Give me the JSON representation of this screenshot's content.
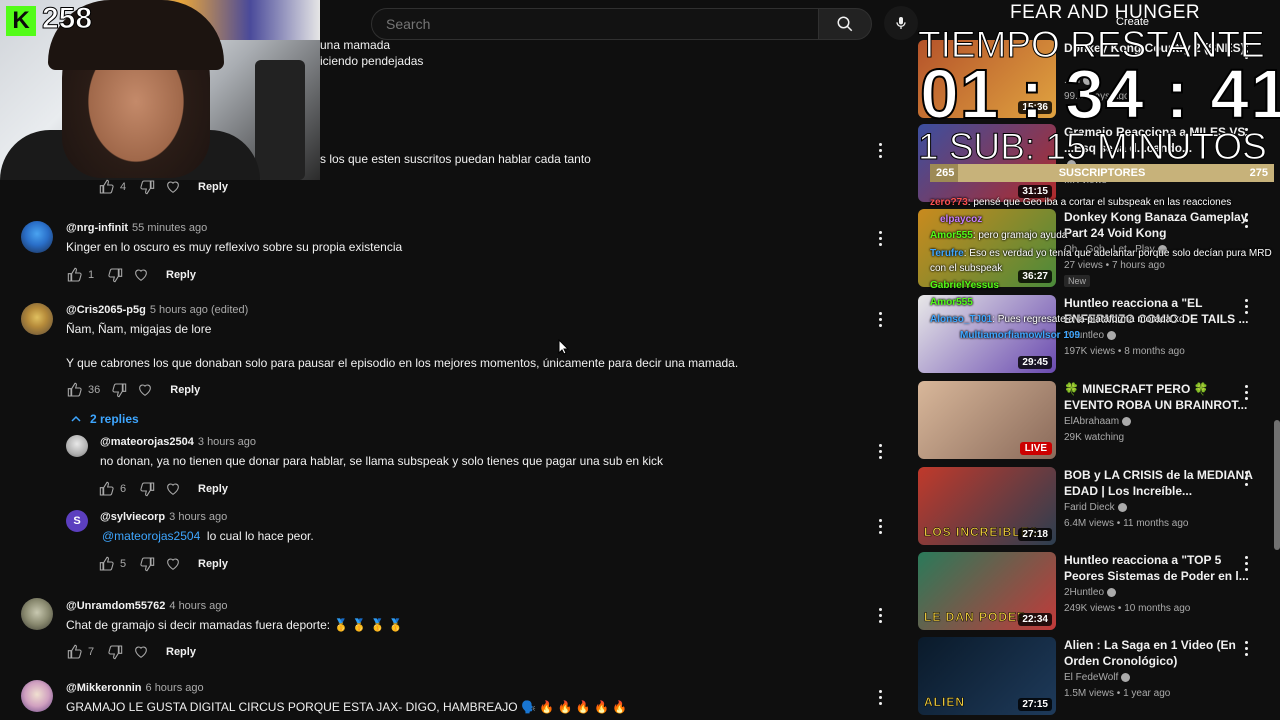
{
  "search": {
    "placeholder": "Search"
  },
  "webcam": {
    "kick_count": "258",
    "kick_letter": "K"
  },
  "partial_comments": [
    {
      "text": "una mamada"
    },
    {
      "text": "iciendo pendejadas"
    },
    {
      "text": "s los que esten suscritos puedan hablar cada tanto"
    }
  ],
  "partial_actions": {
    "likes": "4",
    "reply_label": "Reply"
  },
  "comments": [
    {
      "author": "@nrg-infinit",
      "time": "55 minutes ago",
      "text": "Kinger en lo oscuro es muy reflexivo sobre su propia existencia",
      "likes": "1",
      "reply_label": "Reply"
    },
    {
      "author": "@Cris2065-p5g",
      "time": "5 hours ago (edited)",
      "text": "Ñam, Ñam, migajas de lore",
      "text2": "Y que cabrones los que donaban solo para pausar el episodio en los mejores momentos, únicamente para decir una mamada.",
      "likes": "36",
      "reply_label": "Reply",
      "replies_label": "2 replies"
    },
    {
      "author": "@mateorojas2504",
      "time": "3 hours ago",
      "text": "no donan, ya no tienen que donar para hablar, se llama subspeak y solo tienes que pagar una sub en kick",
      "likes": "6",
      "reply_label": "Reply"
    },
    {
      "author": "@sylviecorp",
      "time": "3 hours ago",
      "mention": "@mateorojas2504",
      "text": "lo cual lo hace peor.",
      "likes": "5",
      "reply_label": "Reply",
      "avatar_letter": "S"
    },
    {
      "author": "@Unramdom55762",
      "time": "4 hours ago",
      "text": "Chat de gramajo si decir mamadas fuera deporte: 🥇 🥇 🥇 🥇",
      "likes": "7",
      "reply_label": "Reply"
    },
    {
      "author": "@Mikkeronnin",
      "time": "6 hours ago",
      "text": "GRAMAJO LE GUSTA DIGITAL CIRCUS PORQUE ESTA JAX- DIGO, HAMBREAJO 🗣️ 🔥 🔥 🔥 🔥 🔥"
    }
  ],
  "overlay": {
    "title": "FEAR AND HUNGER",
    "create": "Create",
    "big": "TIEMPO RESTANTE",
    "timer": "01 : 34 : 41",
    "sub_rule": "1 SUB: 15 MINUTOS",
    "subs_min": "265",
    "subs_label": "SUSCRIPTORES",
    "subs_max": "275"
  },
  "chat": [
    {
      "user": "zero?73",
      "msg": ": pensé que Geo iba a cortar el subspeak en las reacciones"
    },
    {
      "user": "elpaycoz",
      "msg": ""
    },
    {
      "user": "Amor555",
      "msg": ": pero gramajo ayuda"
    },
    {
      "user": "Terufre",
      "msg": ": Eso es verdad yo tenía que adelantar porque solo decían pura MRD"
    },
    {
      "user": "",
      "msg": "con el subspeak"
    },
    {
      "user": "GabrielYessus",
      "msg": ""
    },
    {
      "user": "Amor555",
      "msg": ""
    },
    {
      "user": "Alonso_TJ01",
      "msg": ": Pues regresate a la plataforma morada xd"
    },
    {
      "user": "Multiamorfiamowlsor 109",
      "msg": ""
    }
  ],
  "videos": [
    {
      "title": "Donkey Kong Country 2 (SNES)",
      "channel": "...ni",
      "meta": "99... ...ays ago",
      "duration": "15:36",
      "colors": [
        "#b5532a",
        "#e0a340"
      ]
    },
    {
      "title": "Gramajo Reacciona a MILES VS ...Esq se la d...cando...",
      "channel": "",
      "meta": "...K views",
      "duration": "31:15",
      "colors": [
        "#3b4fa0",
        "#b22a2a"
      ]
    },
    {
      "title": "Donkey Kong Banaza Gameplay Part 24 Void Kong",
      "channel": "Oh...Goh...Let...Play",
      "meta": "27 views • 7 hours ago",
      "new": "New",
      "duration": "36:27",
      "colors": [
        "#c98a1e",
        "#4a8a3a"
      ]
    },
    {
      "title": "Huntleo reacciona a \"EL ENFERMIZO COMIC DE TAILS ...",
      "channel": "2Huntleo",
      "meta": "197K views • 8 months ago",
      "duration": "29:45",
      "colors": [
        "#e8e8e8",
        "#6a4ab0"
      ]
    },
    {
      "title": "🍀 MINECRAFT PERO 🍀 EVENTO ROBA UN BRAINROT...",
      "channel": "ElAbrahaam",
      "meta": "29K watching",
      "live": "LIVE",
      "colors": [
        "#d8b79a",
        "#8a6a5a"
      ]
    },
    {
      "title": "BOB y LA CRISIS de la MEDIANA EDAD | Los Increíble...",
      "channel": "Farid Dieck",
      "meta": "6.4M views • 11 months ago",
      "duration": "27:18",
      "colors": [
        "#c0392b",
        "#2c3e50"
      ]
    },
    {
      "title": "Huntleo reacciona a \"TOP 5 Peores Sistemas de Poder en l...",
      "channel": "2Huntleo",
      "meta": "249K views • 10 months ago",
      "duration": "22:34",
      "colors": [
        "#2a7a5a",
        "#c23a3a"
      ]
    },
    {
      "title": "Alien : La Saga en 1 Video (En Orden Cronológico)",
      "channel": "El FedeWolf",
      "meta": "1.5M views • 1 year ago",
      "duration": "27:15",
      "colors": [
        "#0a1a2a",
        "#1e3a5a"
      ]
    }
  ],
  "thumb_texts": {
    "t6": "LOS INCREIBLES",
    "t7": "LE DAN PODER",
    "t8": "ALIEN"
  },
  "colors": {
    "accent": "#3ea6ff",
    "kick": "#53fc18",
    "live": "#cc0000",
    "bar": "#c7b27a"
  }
}
